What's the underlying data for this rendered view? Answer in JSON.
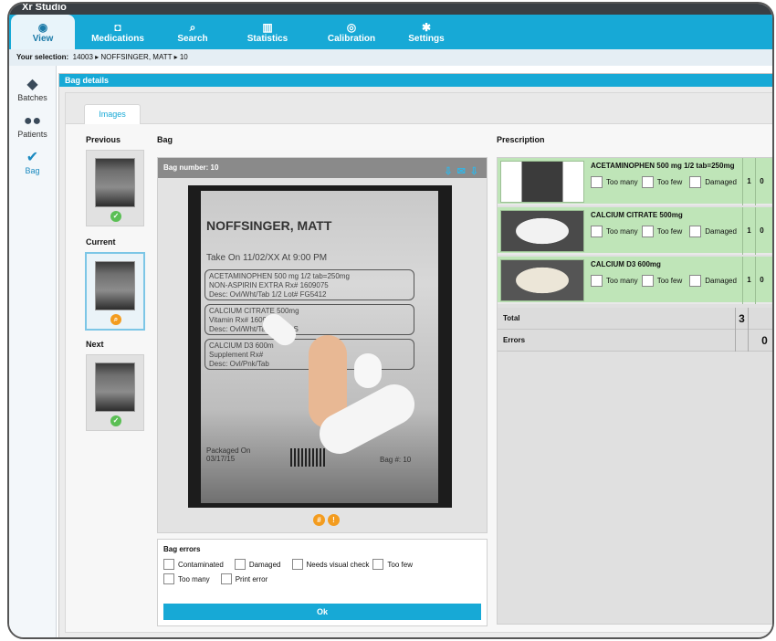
{
  "app": {
    "title": "Xr Studio"
  },
  "nav": {
    "tabs": [
      {
        "label": "View",
        "icon": "eye-icon"
      },
      {
        "label": "Medications",
        "icon": "camera-icon"
      },
      {
        "label": "Search",
        "icon": "search-icon"
      },
      {
        "label": "Statistics",
        "icon": "bar-chart-icon"
      },
      {
        "label": "Calibration",
        "icon": "target-icon"
      },
      {
        "label": "Settings",
        "icon": "gear-icon"
      }
    ]
  },
  "selection": {
    "label": "Your selection:",
    "patient_id": "14003",
    "patient_name": "NOFFSINGER, MATT",
    "bag": "10"
  },
  "sidebar": {
    "items": [
      {
        "label": "Batches",
        "icon": "tags-icon"
      },
      {
        "label": "Patients",
        "icon": "users-icon"
      },
      {
        "label": "Bag",
        "icon": "check-icon"
      }
    ]
  },
  "panel": {
    "title": "Bag details",
    "tab": "Images"
  },
  "thumbs": {
    "previous": "Previous",
    "current": "Current",
    "next": "Next"
  },
  "bag": {
    "label": "Bag",
    "number_label": "Bag number: 10",
    "photo": {
      "patient": "NOFFSINGER, MATT",
      "take_on": "Take On 11/02/XX At 9:00 PM",
      "rx": [
        {
          "line1": "ACETAMINOPHEN 500 mg 1/2 tab=250mg",
          "line2": "NON-ASPIRIN EXTRA    Rx# 1609075",
          "line3": "Desc: Ovl/Wht/Tab 1/2   Lot# FG5412"
        },
        {
          "line1": "CALCIUM CITRATE 500mg",
          "line2": "Vitamin              Rx# 1609075",
          "line3": "Desc: Ovl/Wht/Tab      Lot# GS"
        },
        {
          "line1": "CALCIUM D3 600m",
          "line2": "Supplement           Rx#",
          "line3": "Desc: Ovl/Pnk/Tab"
        }
      ],
      "packaged": "Packaged On 03/17/15",
      "bag_no": "Bag #: 10"
    }
  },
  "bag_errors": {
    "title": "Bag errors",
    "options": [
      "Contaminated",
      "Damaged",
      "Needs visual check",
      "Too few",
      "Too many",
      "Print error"
    ],
    "ok": "Ok"
  },
  "prescription": {
    "label": "Prescription",
    "options": [
      "Too many",
      "Too few",
      "Damaged"
    ],
    "items": [
      {
        "name": "ACETAMINOPHEN 500 mg 1/2 tab=250mg",
        "count": "1",
        "errors": "0"
      },
      {
        "name": "CALCIUM CITRATE 500mg",
        "count": "1",
        "errors": "0"
      },
      {
        "name": "CALCIUM D3 600mg",
        "count": "1",
        "errors": "0"
      }
    ],
    "total_label": "Total",
    "total": "3",
    "errors_label": "Errors",
    "errors": "0"
  },
  "colors": {
    "accent": "#17a9d6",
    "ok": "#5bbf55",
    "warn": "#f39c1f",
    "rx_bg": "#bfe5b8"
  }
}
